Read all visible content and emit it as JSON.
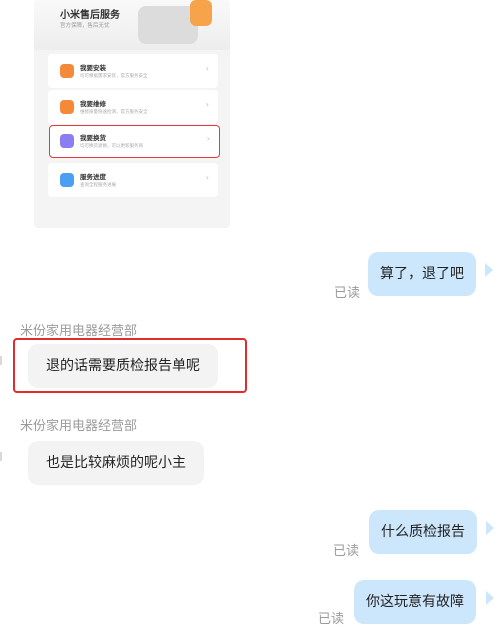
{
  "service_card": {
    "title": "小米售后服务",
    "subtitle": "官方保障，售后无忧",
    "items": [
      {
        "title": "我要安装",
        "desc": "均可根据需求安装，官方服务安全",
        "icon": "wrench-icon",
        "color": "#f5893a"
      },
      {
        "title": "我要维修",
        "desc": "维修质量快速检测，官方服务安全",
        "icon": "hammer-icon",
        "color": "#f5893a"
      },
      {
        "title": "我要换货",
        "desc": "均可换货退换，可以更新服务商",
        "icon": "exchange-icon",
        "color": "#8b7ef0"
      },
      {
        "title": "服务进度",
        "desc": "查询全程服务进展",
        "icon": "progress-icon",
        "color": "#4b9ff1"
      }
    ]
  },
  "messages": [
    {
      "side": "right",
      "text": "算了，退了吧",
      "status": "已读"
    },
    {
      "side": "left",
      "sender": "米份家用电器经营部",
      "text": "退的话需要质检报告单呢"
    },
    {
      "side": "left",
      "sender": "米份家用电器经营部",
      "text": "也是比较麻烦的呢小主"
    },
    {
      "side": "right",
      "text": "什么质检报告",
      "status": "已读"
    },
    {
      "side": "right",
      "text": "你这玩意有故障",
      "status": "已读"
    }
  ]
}
